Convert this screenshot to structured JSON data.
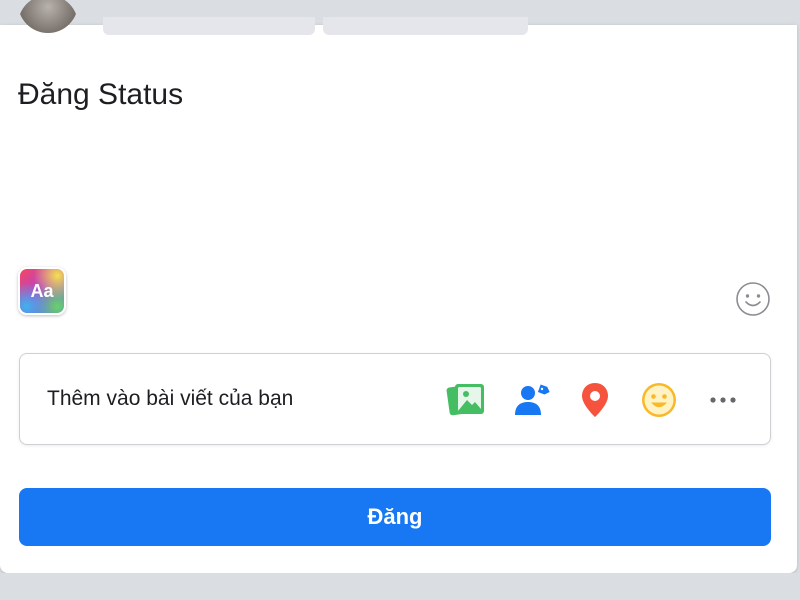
{
  "composer": {
    "placeholder": "Đăng Status",
    "text_format_label": "Aa"
  },
  "add_to_post": {
    "label": "Thêm vào bài viết của bạn",
    "tools": [
      {
        "icon": "photo-video-icon",
        "color": "#45bd62"
      },
      {
        "icon": "tag-people-icon",
        "color": "#1877f2"
      },
      {
        "icon": "location-pin-icon",
        "color": "#f5533d"
      },
      {
        "icon": "feeling-emoji-icon",
        "color": "#f7b928"
      },
      {
        "icon": "more-options-icon",
        "color": "#65676b"
      }
    ]
  },
  "post_button": {
    "label": "Đăng"
  },
  "colors": {
    "primary": "#1877f2",
    "background": "#dadde1",
    "card": "#ffffff",
    "text": "#1c1e21"
  }
}
